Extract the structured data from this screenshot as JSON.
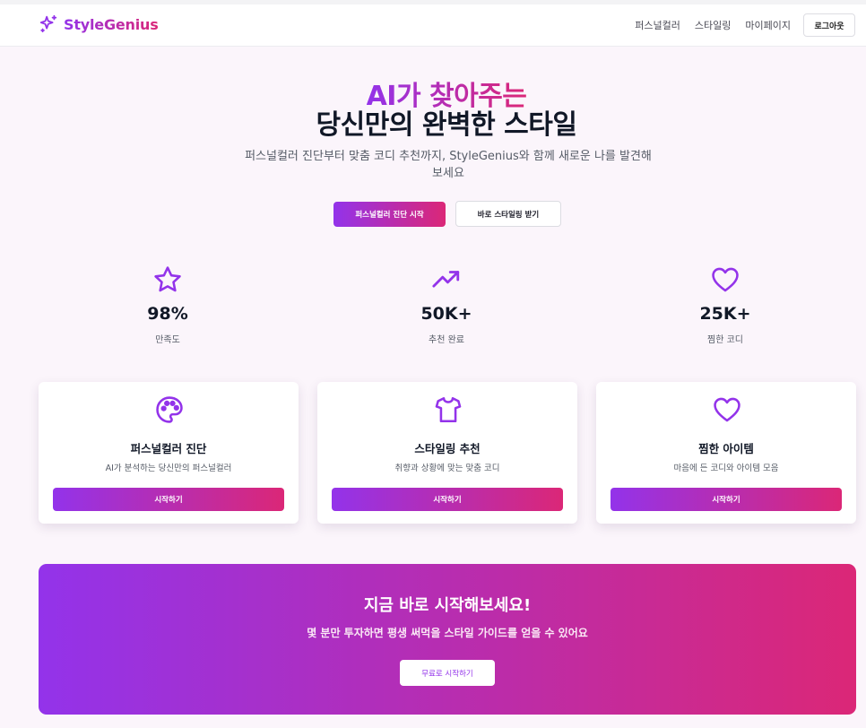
{
  "brand": {
    "name": "StyleGenius",
    "icon": "sparkles-icon"
  },
  "nav": {
    "links": [
      "퍼스널컬러",
      "스타일링",
      "마이페이지"
    ],
    "logout_label": "로그아웃"
  },
  "hero": {
    "title_line1": "AI가 찾아주는",
    "title_line2": "당신만의 완벽한 스타일",
    "subtitle": "퍼스널컬러 진단부터 맞춤 코디 추천까지, StyleGenius와 함께 새로운 나를 발견해보세요",
    "primary_button": "퍼스널컬러 진단 시작",
    "secondary_button": "바로 스타일링 받기"
  },
  "stats": [
    {
      "icon": "star-icon",
      "value": "98%",
      "label": "만족도"
    },
    {
      "icon": "trending-up-icon",
      "value": "50K+",
      "label": "추천 완료"
    },
    {
      "icon": "heart-icon",
      "value": "25K+",
      "label": "찜한 코디"
    }
  ],
  "features": [
    {
      "icon": "palette-icon",
      "title": "퍼스널컬러 진단",
      "description": "AI가 분석하는 당신만의 퍼스널컬러",
      "button": "시작하기"
    },
    {
      "icon": "shirt-icon",
      "title": "스타일링 추천",
      "description": "취향과 상황에 맞는 맞춤 코디",
      "button": "시작하기"
    },
    {
      "icon": "heart-icon",
      "title": "찜한 아이템",
      "description": "마음에 든 코디와 아이템 모음",
      "button": "시작하기"
    }
  ],
  "cta": {
    "title": "지금 바로 시작해보세요!",
    "subtitle": "몇 분만 투자하면 평생 써먹을 스타일 가이드를 얻을 수 있어요",
    "button": "무료로 시작하기"
  },
  "colors": {
    "accent_start": "#9333ea",
    "accent_end": "#db2777",
    "icon": "#9333ea"
  }
}
